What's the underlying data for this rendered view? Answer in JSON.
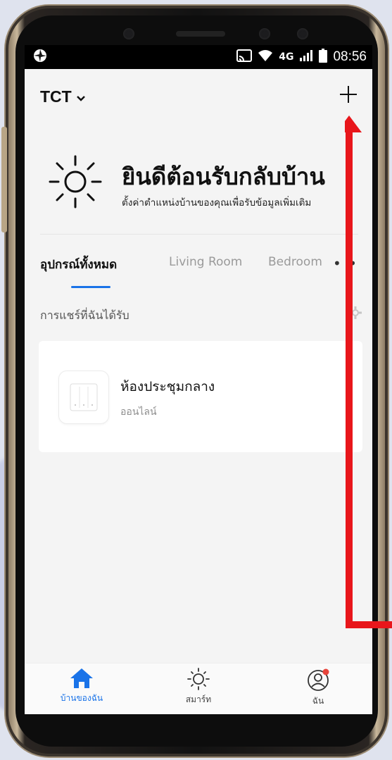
{
  "status_bar": {
    "time": "08:56",
    "network": "4G"
  },
  "header": {
    "home_name": "TCT",
    "chevron": "chevron-down-icon",
    "add_icon": "plus-icon"
  },
  "welcome": {
    "title": "ยินดีต้อนรับกลับบ้าน",
    "subtitle": "ตั้งค่าตำแหน่งบ้านของคุณเพื่อรับข้อมูลเพิ่มเติม",
    "icon": "sun-icon"
  },
  "tabs": [
    {
      "label": "อุปกรณ์ทั้งหมด",
      "active": true
    },
    {
      "label": "Living Room",
      "active": false
    },
    {
      "label": "Bedroom",
      "active": false
    }
  ],
  "tabs_more": "• •",
  "shared_section": {
    "label": "การแชร์ที่ฉันได้รับ",
    "icon": "gear-icon"
  },
  "devices": [
    {
      "name": "ห้องประชุมกลาง",
      "status": "ออนไลน์",
      "icon": "switch-panel-icon"
    }
  ],
  "bottom_nav": [
    {
      "label": "บ้านของฉัน",
      "icon": "home-icon",
      "active": true
    },
    {
      "label": "สมาร์ท",
      "icon": "sun-icon",
      "active": false
    },
    {
      "label": "ฉัน",
      "icon": "profile-icon",
      "active": false
    }
  ],
  "colors": {
    "accent": "#1a73e8",
    "annotation_arrow": "#e8161b",
    "notification_dot": "#e8453c"
  }
}
